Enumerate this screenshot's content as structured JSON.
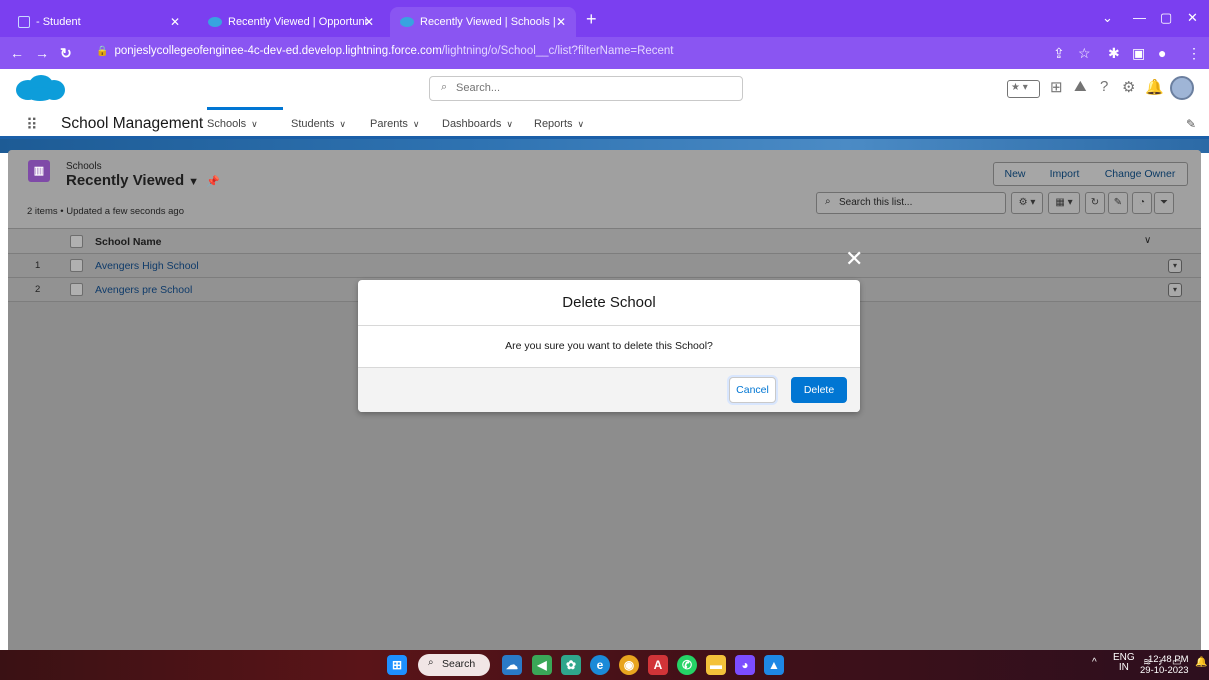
{
  "browser": {
    "tabs": [
      {
        "title": "- Student"
      },
      {
        "title": "Recently Viewed | Opportunities"
      },
      {
        "title": "Recently Viewed | Schools | Sale"
      }
    ],
    "new_tab": "+",
    "url_host": "ponjeslycollegeofenginee-4c-dev-ed.develop.lightning.force.com",
    "url_path": "/lightning/o/School__c/list?filterName=Recent"
  },
  "header": {
    "search_placeholder": "Search..."
  },
  "app": {
    "name": "School Management",
    "nav": [
      {
        "label": "Schools"
      },
      {
        "label": "Students"
      },
      {
        "label": "Parents"
      },
      {
        "label": "Dashboards"
      },
      {
        "label": "Reports"
      }
    ]
  },
  "list": {
    "object_label": "Schools",
    "view_name": "Recently Viewed",
    "meta": "2 items • Updated a few seconds ago",
    "buttons": {
      "new": "New",
      "import": "Import",
      "change_owner": "Change Owner"
    },
    "search_placeholder": "Search this list...",
    "column": "School Name",
    "rows": [
      {
        "num": "1",
        "name": "Avengers High School"
      },
      {
        "num": "2",
        "name": "Avengers pre School"
      }
    ]
  },
  "modal": {
    "title": "Delete School",
    "body": "Are you sure you want to delete this School?",
    "cancel": "Cancel",
    "delete": "Delete"
  },
  "taskbar": {
    "search": "Search",
    "lang_top": "ENG",
    "lang_bottom": "IN",
    "time": "12:48 PM",
    "date": "29-10-2023"
  },
  "colors": {
    "browser_frame": "#7b3ff0",
    "sf_blue": "#0176d3",
    "object_icon": "#7f4aa8"
  }
}
